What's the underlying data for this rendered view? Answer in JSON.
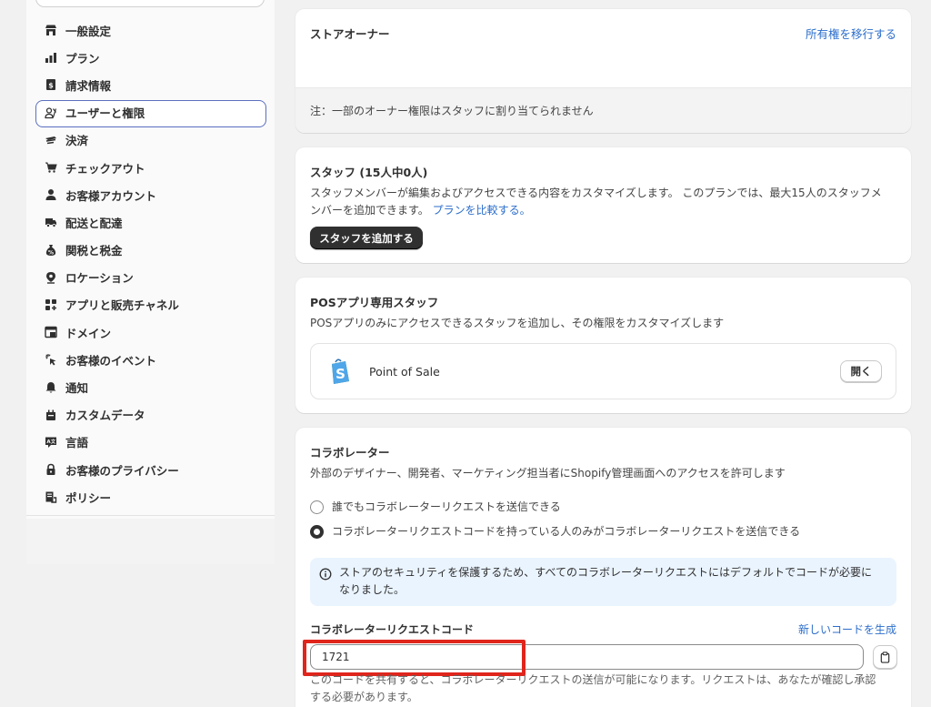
{
  "sidebar": {
    "items": [
      {
        "label": "一般設定",
        "icon": "store-icon"
      },
      {
        "label": "プラン",
        "icon": "plan-chart-icon"
      },
      {
        "label": "請求情報",
        "icon": "billing-icon"
      },
      {
        "label": "ユーザーと権限",
        "icon": "users-icon",
        "active": true
      },
      {
        "label": "決済",
        "icon": "payments-icon"
      },
      {
        "label": "チェックアウト",
        "icon": "cart-icon"
      },
      {
        "label": "お客様アカウント",
        "icon": "person-icon"
      },
      {
        "label": "配送と配達",
        "icon": "truck-icon"
      },
      {
        "label": "関税と税金",
        "icon": "tax-bag-icon"
      },
      {
        "label": "ロケーション",
        "icon": "location-pin-icon"
      },
      {
        "label": "アプリと販売チャネル",
        "icon": "apps-icon"
      },
      {
        "label": "ドメイン",
        "icon": "domain-icon"
      },
      {
        "label": "お客様のイベント",
        "icon": "cursor-click-icon"
      },
      {
        "label": "通知",
        "icon": "bell-icon"
      },
      {
        "label": "カスタムデータ",
        "icon": "database-icon"
      },
      {
        "label": "言語",
        "icon": "language-icon"
      },
      {
        "label": "お客様のプライバシー",
        "icon": "lock-icon"
      },
      {
        "label": "ポリシー",
        "icon": "policy-icon"
      }
    ]
  },
  "owner_card": {
    "title": "ストアオーナー",
    "transfer_link": "所有権を移行する",
    "note": "注：一部のオーナー権限はスタッフに割り当てられません"
  },
  "staff_card": {
    "title": "スタッフ (15人中0人)",
    "description_line1": "スタッフメンバーが編集およびアクセスできる内容をカスタマイズします。 このプランでは、最大15人のスタッフメ",
    "description_line2": "ンバーを追加できます。",
    "compare_link": "プランを比較する。",
    "add_button": "スタッフを追加する"
  },
  "pos_card": {
    "title": "POSアプリ専用スタッフ",
    "description": "POSアプリのみにアクセスできるスタッフを追加し、その権限をカスタマイズします",
    "app_name": "Point of Sale",
    "open_button": "開く"
  },
  "collab_card": {
    "title": "コラボレーター",
    "description": "外部のデザイナー、開発者、マーケティング担当者にShopify管理画面へのアクセスを許可します",
    "option_anyone": "誰でもコラボレーターリクエストを送信できる",
    "option_code_only": "コラボレーターリクエストコードを持っている人のみがコラボレーターリクエストを送信できる",
    "banner_line1": "ストアのセキュリティを保護するため、すべてのコラボレーターリクエストにはデフォルトでコードが必要に",
    "banner_line2": "なりました。",
    "code_label": "コラボレーターリクエストコード",
    "generate_link": "新しいコードを生成",
    "code_value": "1721",
    "help_line1": "このコードを共有すると、コラボレーターリクエストの送信が可能になります。リクエストは、あなたが確認し承認",
    "help_line2": "する必要があります。"
  },
  "colors": {
    "accent_link": "#2c6ecb",
    "active_outline": "#5a6fbf",
    "highlight": "#e0251c",
    "banner_bg": "#eaf4ff"
  }
}
